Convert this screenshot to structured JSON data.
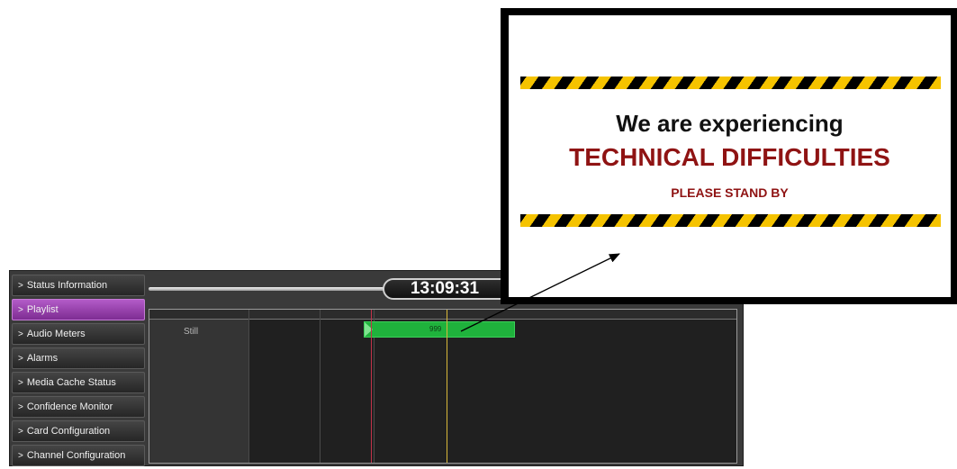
{
  "sidebar": {
    "items": [
      {
        "label": "Status Information",
        "active": false
      },
      {
        "label": "Playlist",
        "active": true
      },
      {
        "label": "Audio Meters",
        "active": false
      },
      {
        "label": "Alarms",
        "active": false
      },
      {
        "label": "Media Cache Status",
        "active": false
      },
      {
        "label": "Confidence Monitor",
        "active": false
      },
      {
        "label": "Card Configuration",
        "active": false
      },
      {
        "label": "Channel Configuration",
        "active": false
      }
    ],
    "chevron": ">"
  },
  "clock": {
    "time": "13:09:31"
  },
  "timeline": {
    "track_label": "Still",
    "clip_label": "999"
  },
  "preview": {
    "line1": "We are experiencing",
    "line2": "TECHNICAL DIFFICULTIES",
    "line3": "PLEASE STAND BY"
  },
  "colors": {
    "active_nav": "#9c45b3",
    "clip_green": "#1fb23c",
    "now_line": "#c2334a",
    "cursor_line": "#d9b83a",
    "hazard_yellow": "#f5c300",
    "warning_red": "#8f1313"
  }
}
